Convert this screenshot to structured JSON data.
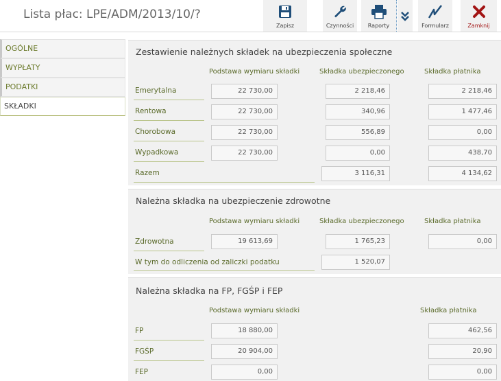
{
  "header": {
    "title": "Lista płac: LPE/ADM/2013/10/?",
    "buttons": {
      "save": "Zapisz",
      "actions": "Czynności",
      "reports": "Raporty",
      "form": "Formularz",
      "close": "Zamknij"
    }
  },
  "sidebar": {
    "items": [
      {
        "label": "OGÓLNE"
      },
      {
        "label": "WYPŁATY"
      },
      {
        "label": "PODATKI"
      },
      {
        "label": "SKŁADKI"
      }
    ]
  },
  "social": {
    "title": "Zestawienie należnych składek na ubezpieczenia społeczne",
    "headers": [
      "Podstawa wymiaru składki",
      "Składka ubezpieczonego",
      "Składka płatnika"
    ],
    "rows": [
      {
        "label": "Emerytalna",
        "base": "22 730,00",
        "insured": "2 218,46",
        "payer": "2 218,46"
      },
      {
        "label": "Rentowa",
        "base": "22 730,00",
        "insured": "340,96",
        "payer": "1 477,46"
      },
      {
        "label": "Chorobowa",
        "base": "22 730,00",
        "insured": "556,89",
        "payer": "0,00"
      },
      {
        "label": "Wypadkowa",
        "base": "22 730,00",
        "insured": "0,00",
        "payer": "438,70"
      }
    ],
    "total": {
      "label": "Razem",
      "insured": "3 116,31",
      "payer": "4 134,62"
    }
  },
  "health": {
    "title": "Należna składka na ubezpieczenie zdrowotne",
    "headers": [
      "Podstawa wymiaru składki",
      "Składka ubezpieczonego",
      "Składka płatnika"
    ],
    "row": {
      "label": "Zdrowotna",
      "base": "19 613,69",
      "insured": "1 765,23",
      "payer": "0,00"
    },
    "deduction": {
      "label": "W tym do odliczenia od zaliczki podatku",
      "value": "1 520,07"
    }
  },
  "funds": {
    "title": "Należna składka na FP, FGŚP i FEP",
    "headers": [
      "Podstawa wymiaru składki",
      "Składka płatnika"
    ],
    "rows": [
      {
        "label": "FP",
        "base": "18 880,00",
        "payer": "462,56"
      },
      {
        "label": "FGŚP",
        "base": "20 904,00",
        "payer": "20,90"
      },
      {
        "label": "FEP",
        "base": "0,00",
        "payer": "0,00"
      }
    ]
  }
}
